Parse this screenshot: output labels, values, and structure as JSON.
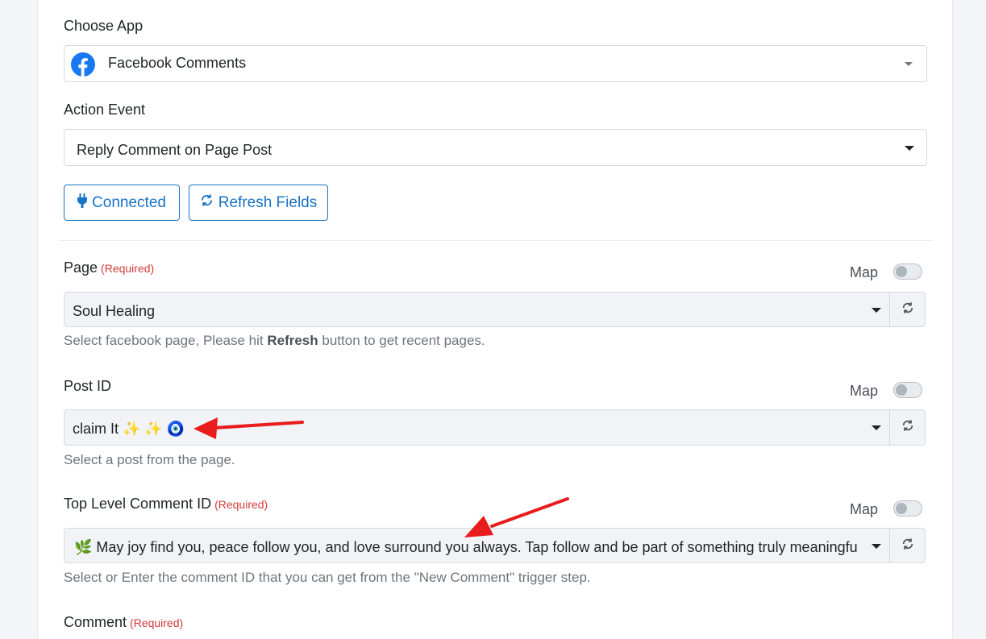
{
  "choose_app": {
    "label": "Choose App",
    "value": "Facebook Comments",
    "icon": "facebook-icon"
  },
  "action_event": {
    "label": "Action Event",
    "value": "Reply Comment on Page Post"
  },
  "buttons": {
    "connected": "Connected",
    "refresh_fields": "Refresh Fields"
  },
  "page_field": {
    "label": "Page",
    "required": "(Required)",
    "map_label": "Map",
    "value": "Soul Healing",
    "help_pre": "Select facebook page, Please hit ",
    "help_bold": "Refresh",
    "help_post": " button to get recent pages."
  },
  "post_field": {
    "label": "Post ID",
    "map_label": "Map",
    "value": "claim It ✨ ✨ 🧿",
    "help": "Select a post from the page."
  },
  "comment_id_field": {
    "label": "Top Level Comment ID",
    "required": "(Required)",
    "map_label": "Map",
    "value": "🌿 May joy find you, peace follow you, and love surround you always. Tap follow and be part of something truly meaningful",
    "help": "Select or Enter the comment ID that you can get from the \"New Comment\" trigger step."
  },
  "comment_field": {
    "label": "Comment",
    "required": "(Required)"
  },
  "colors": {
    "accent": "#1a73c8",
    "required": "#d33a3a",
    "arrow": "#e81c1c"
  }
}
